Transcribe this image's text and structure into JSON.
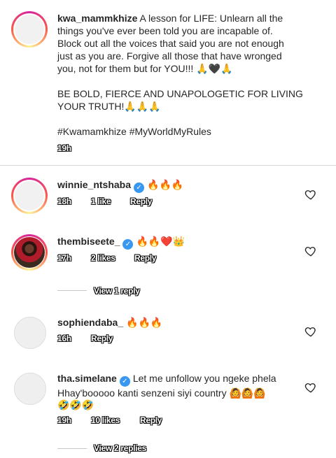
{
  "caption": {
    "username": "kwa_mammkhize",
    "lines": [
      "A lesson for LIFE: Unlearn all the",
      "things you've ever been told you are incapable of.",
      "Block out all the voices that said you are not enough",
      "just as you are. Forgive all those that have wronged",
      "you, not for them but for YOU!!! 🙏🖤🙏",
      "",
      "BE BOLD, FIERCE AND UNAPOLOGETIC FOR LIVING",
      "YOUR TRUTH!🙏🙏🙏",
      "",
      "#Kwamamkhize #MyWorldMyRules"
    ],
    "time": "19h"
  },
  "comments": [
    {
      "username": "winnie_ntshaba",
      "verified": true,
      "text": "🔥🔥🔥",
      "time": "18h",
      "likes": "1 like",
      "reply": "Reply"
    },
    {
      "username": "thembiseete_",
      "verified": true,
      "text": "🔥🔥❤️👑",
      "time": "17h",
      "likes": "2 likes",
      "reply": "Reply",
      "view_replies": "View 1 reply"
    },
    {
      "username": "sophiendaba_",
      "verified": false,
      "text": "🔥🔥🔥",
      "time": "16h",
      "reply": "Reply"
    },
    {
      "username": "tha.simelane",
      "verified": true,
      "text_line1": "Let me unfollow you ngeke phela",
      "text_line2": "Hhay'booooo kanti senzeni siyi country 🙆🙆🙆",
      "text_line3": "🤣🤣🤣",
      "time": "19h",
      "likes": "10 likes",
      "reply": "Reply",
      "view_replies": "View 2 replies"
    }
  ],
  "icons": {
    "heart": "heart-outline-icon",
    "verified": "verified-badge-icon"
  },
  "colors": {
    "verified": "#3897f0",
    "divider": "#dbdbdb"
  }
}
